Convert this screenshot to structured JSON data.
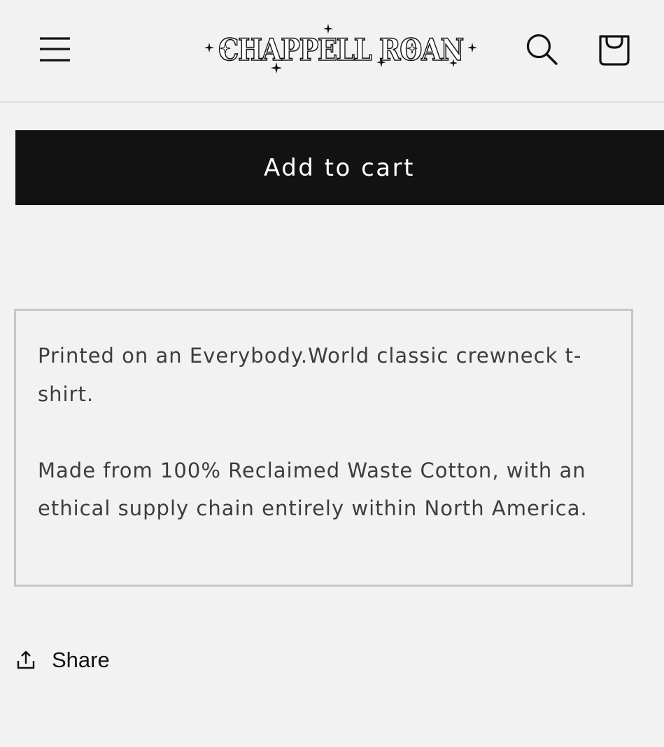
{
  "header": {
    "logo_text": "CHAPPELL ROAN",
    "menu_icon": "hamburger-menu-icon",
    "search_icon": "search-icon",
    "cart_icon": "shopping-bag-icon"
  },
  "product": {
    "add_to_cart_label": "Add to cart",
    "description": {
      "paragraph_1": "Printed on an Everybody.World classic crewneck t-shirt.",
      "paragraph_2": "Made from 100% Reclaimed Waste Cotton, with an ethical supply chain entirely within North America."
    },
    "share_label": "Share",
    "share_icon": "share-upload-icon"
  },
  "colors": {
    "background": "#f2f2f2",
    "button_bg": "#121212",
    "button_text": "#ffffff",
    "body_text": "#3d3d3d",
    "border": "#c7c7c7"
  }
}
